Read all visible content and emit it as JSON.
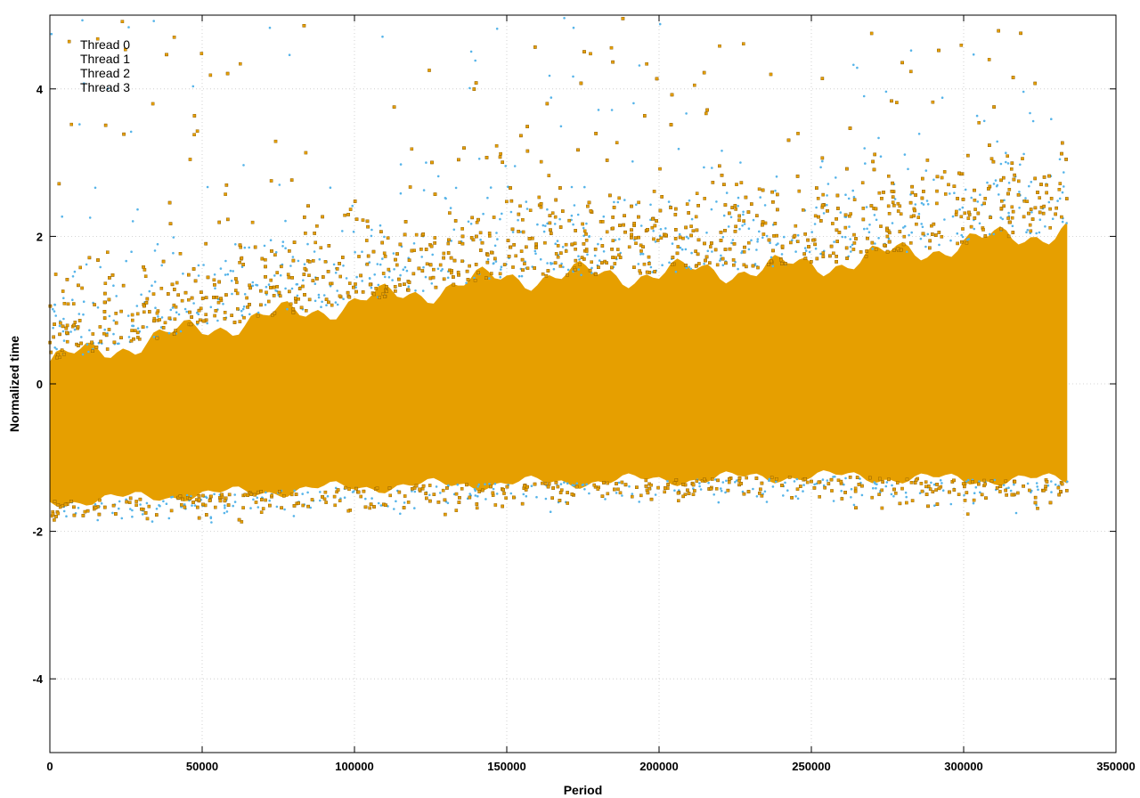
{
  "chart_data": {
    "type": "scatter",
    "xlabel": "Period",
    "ylabel": "Normalized time",
    "xlim": [
      0,
      350000
    ],
    "ylim": [
      -5,
      5
    ],
    "x_ticks": [
      0,
      50000,
      100000,
      150000,
      200000,
      250000,
      300000,
      350000
    ],
    "y_ticks": [
      -4,
      -2,
      0,
      2,
      4
    ],
    "grid": true,
    "legend_position": "top-left",
    "series": [
      {
        "name": "Thread 0",
        "color": "#9400d3",
        "marker": "dot"
      },
      {
        "name": "Thread 1",
        "color": "#009e73",
        "marker": "dot"
      },
      {
        "name": "Thread 2",
        "color": "#56b4e9",
        "marker": "dot"
      },
      {
        "name": "Thread 3",
        "color": "#e69f00",
        "marker": "square"
      }
    ],
    "x_data_end": 334000,
    "trend": {
      "x": [
        0,
        50000,
        100000,
        150000,
        200000,
        250000,
        300000,
        334000
      ],
      "center": [
        -0.55,
        -0.4,
        -0.25,
        -0.05,
        0.05,
        0.15,
        0.35,
        0.45
      ],
      "upper": [
        0.3,
        0.75,
        1.1,
        1.45,
        1.5,
        1.6,
        1.9,
        2.1
      ],
      "lower": [
        -1.6,
        -1.5,
        -1.4,
        -1.35,
        -1.3,
        -1.25,
        -1.3,
        -1.3
      ]
    }
  }
}
